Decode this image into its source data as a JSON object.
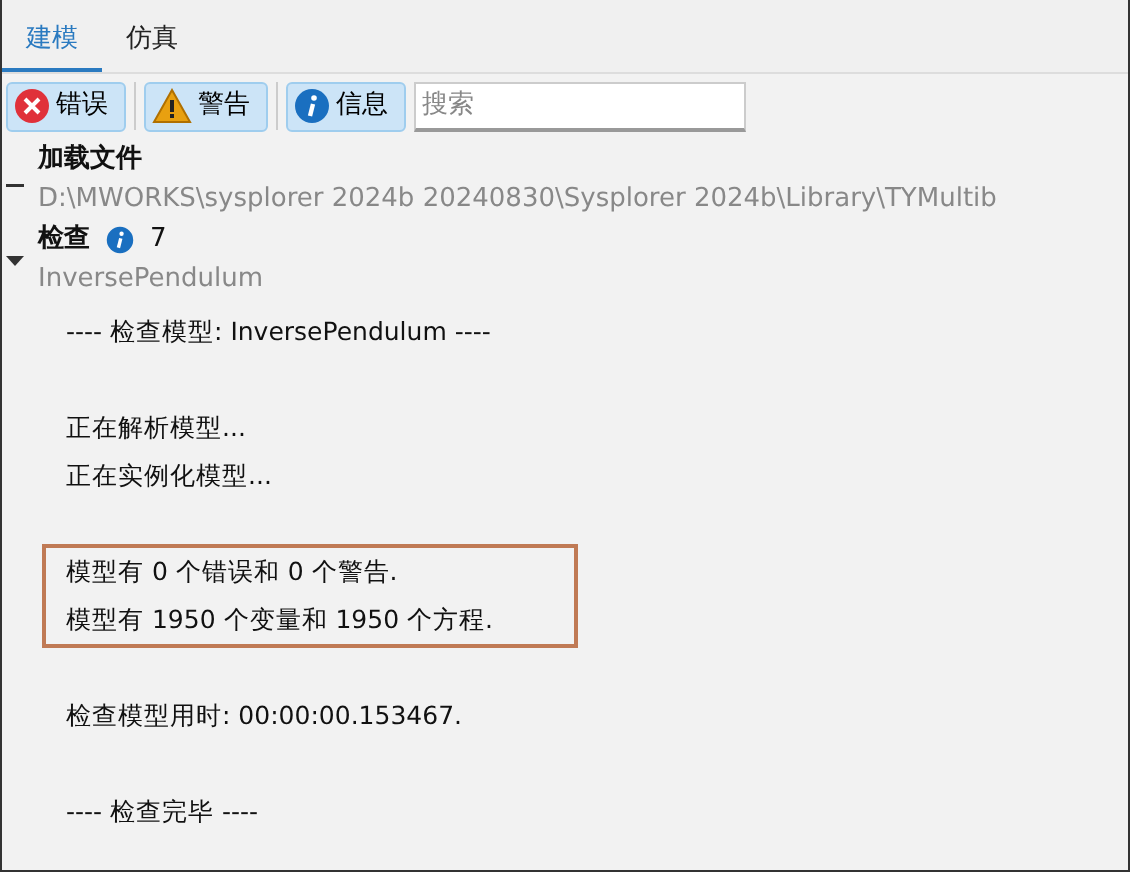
{
  "tabs": [
    {
      "label": "建模",
      "selected": true
    },
    {
      "label": "仿真",
      "selected": false
    }
  ],
  "filters": [
    {
      "kind": "error",
      "label": "错误",
      "selected": true
    },
    {
      "kind": "warning",
      "label": "警告",
      "selected": true
    },
    {
      "kind": "info",
      "label": "信息",
      "selected": true
    }
  ],
  "search": {
    "placeholder": "搜索"
  },
  "entries": [
    {
      "title": "加载文件",
      "subtitle": "D:\\MWORKS\\sysplorer 2024b 20240830\\Sysplorer 2024b\\Library\\TYMultib",
      "expanded": false
    },
    {
      "title": "检查",
      "info_count": "7",
      "subtitle": "InversePendulum",
      "expanded": true
    }
  ],
  "log": [
    {
      "lines": [
        "---- 检查模型: InversePendulum ----"
      ],
      "highlighted": false
    },
    {
      "lines": [
        "正在解析模型...",
        "正在实例化模型..."
      ],
      "highlighted": false
    },
    {
      "lines": [
        "模型有 0 个错误和 0 个警告.",
        "模型有 1950 个变量和 1950 个方程."
      ],
      "highlighted": true
    },
    {
      "lines": [
        "检查模型用时: 00:00:00.153467."
      ],
      "highlighted": false
    },
    {
      "lines": [
        "---- 检查完毕 ----"
      ],
      "highlighted": false
    }
  ]
}
